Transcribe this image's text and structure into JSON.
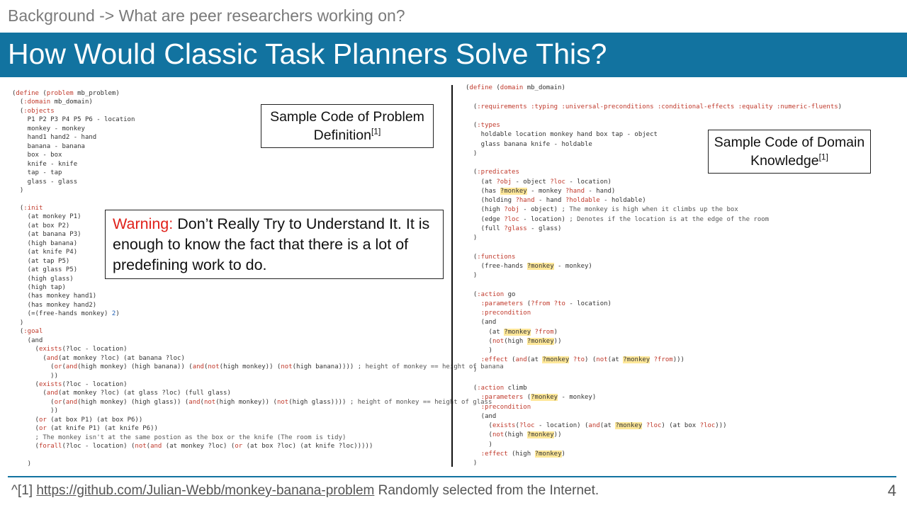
{
  "breadcrumb": "Background -> What are peer researchers working on?",
  "title": "How Would Classic Task Planners Solve This?",
  "problem_box": {
    "text": "Sample Code of Problem Definition",
    "ref": "[1]"
  },
  "domain_box": {
    "text": "Sample Code of Domain Knowledge",
    "ref": "[1]"
  },
  "warning": {
    "label": "Warning:",
    "text": " Don’t Really Try to Understand It. It is enough to know the fact that there is a lot of predefining work to do."
  },
  "footnote": {
    "prefix": "^[1] ",
    "link": "https://github.com/Julian-Webb/monkey-banana-problem",
    "suffix": "  Randomly selected from the Internet."
  },
  "page_number": "4",
  "colors": {
    "title_bar": "#1273a0",
    "warning_label": "#e0221b",
    "keyword": "#c0392b",
    "highlight": "#ffe89a"
  },
  "problem_code": [
    "(define (problem mb_problem)",
    "  (:domain mb_domain)",
    "  (:objects",
    "    P1 P2 P3 P4 P5 P6 - location",
    "    monkey - monkey",
    "    hand1 hand2 - hand",
    "    banana - banana",
    "    box - box",
    "    knife - knife",
    "    tap - tap",
    "    glass - glass",
    "  )",
    "",
    "  (:init",
    "    (at monkey P1)",
    "    (at box P2)",
    "    (at banana P3)",
    "    (high banana)",
    "    (at knife P4)",
    "    (at tap P5)",
    "    (at glass P5)",
    "    (high glass)",
    "    (high tap)",
    "    (has monkey hand1)",
    "    (has monkey hand2)",
    "    (=(free-hands monkey) 2)",
    "  )",
    "  (:goal",
    "    (and",
    "      (exists(?loc - location)",
    "        (and(at monkey ?loc) (at banana ?loc)",
    "          (or(and(high monkey) (high banana)) (and(not(high monkey)) (not(high banana)))) ; height of monkey == height of banana",
    "          ))",
    "      (exists(?loc - location)",
    "        (and(at monkey ?loc) (at glass ?loc) (full glass)",
    "          (or(and(high monkey) (high glass)) (and(not(high monkey)) (not(high glass)))) ; height of monkey == height of glass",
    "          ))",
    "      (or (at box P1) (at box P6))",
    "      (or (at knife P1) (at knife P6))",
    "      ; The monkey isn't at the same postion as the box or the knife (The room is tidy)",
    "      (forall(?loc - location) (not(and (at monkey ?loc) (or (at box ?loc) (at knife ?loc)))))",
    "",
    "    )"
  ],
  "domain_code": [
    "(define (domain mb_domain)",
    "",
    "  (:requirements :typing :universal-preconditions :conditional-effects :equality :numeric-fluents)",
    "",
    "  (:types",
    "    holdable location monkey hand box tap - object",
    "    glass banana knife - holdable",
    "  )",
    "",
    "  (:predicates",
    "    (at ?obj - object ?loc - location)",
    "    (has ?monkey - monkey ?hand - hand)",
    "    (holding ?hand - hand ?holdable - holdable)",
    "    (high ?obj - object) ; The monkey is high when it climbs up the box",
    "    (edge ?loc - location) ; Denotes if the location is at the edge of the room",
    "    (full ?glass - glass)",
    "  )",
    "",
    "  (:functions",
    "    (free-hands ?monkey - monkey)",
    "  )",
    "",
    "  (:action go",
    "    :parameters (?from ?to - location)",
    "    :precondition",
    "    (and",
    "      (at ?monkey ?from)",
    "      (not(high ?monkey))",
    "      )",
    "    :effect (and(at ?monkey ?to) (not(at ?monkey ?from)))",
    "  )",
    "",
    "  (:action climb",
    "    :parameters (?monkey - monkey)",
    "    :precondition",
    "    (and",
    "      (exists(?loc - location) (and(at ?monkey ?loc) (at box ?loc)))",
    "      (not(high ?monkey))",
    "      )",
    "    :effect (high ?monkey)",
    "  )"
  ]
}
